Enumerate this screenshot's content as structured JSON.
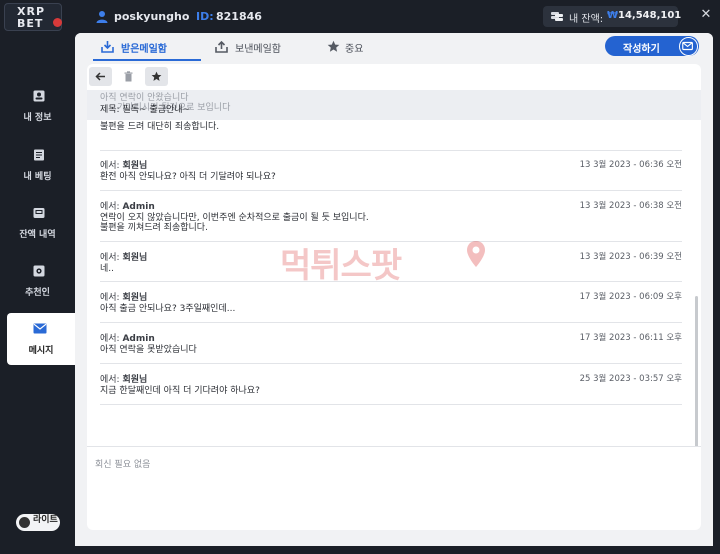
{
  "topbar": {
    "logo_line1": "XRP",
    "logo_line2": "BET",
    "username": "poskyungho",
    "id_label": "ID:",
    "id_value": "821846",
    "balance_label": "내 잔액:",
    "balance_currency": "₩",
    "balance_value": "14,548,101",
    "close_glyph": "✕"
  },
  "sidebar": {
    "items": [
      {
        "label": "내 정보",
        "icon": "id-card-icon"
      },
      {
        "label": "내 베팅",
        "icon": "ledger-icon"
      },
      {
        "label": "잔액 내역",
        "icon": "wallet-icon"
      },
      {
        "label": "추천인",
        "icon": "referral-icon"
      },
      {
        "label": "메시지",
        "icon": "envelope-icon"
      }
    ],
    "toggle_label": "라이트"
  },
  "tabs": {
    "inbox": "받은메일함",
    "sent": "보낸메일함",
    "important": "중요",
    "compose": "작성하기"
  },
  "thread": {
    "ghost_line1": "아직 연락이 안왔습니다",
    "ghost_line2": "기다리시면 될것으로 보입니다",
    "subject": "제목: 필독~ 출금안내~",
    "top_body": "불편을 드려 대단히 죄송합니다.",
    "messages": [
      {
        "from_prefix": "에서:",
        "from": "회원님",
        "date": "13 3월 2023 - 06:36 오전",
        "body": [
          "환전 아직 안되나요? 아직 더 기달려야 되나요?"
        ]
      },
      {
        "from_prefix": "에서:",
        "from": "Admin",
        "date": "13 3월 2023 - 06:38 오전",
        "body": [
          "연락이 오지 않았습니다만, 이번주엔 순차적으로 출금이 될 듯 보입니다.",
          "불편을 끼쳐드려 죄송합니다."
        ]
      },
      {
        "from_prefix": "에서:",
        "from": "회원님",
        "date": "13 3월 2023 - 06:39 오전",
        "body": [
          "네.."
        ]
      },
      {
        "from_prefix": "에서:",
        "from": "회원님",
        "date": "17 3월 2023 - 06:09 오후",
        "body": [
          "아직 출금 안되나요? 3주일째인데..."
        ]
      },
      {
        "from_prefix": "에서:",
        "from": "Admin",
        "date": "17 3월 2023 - 06:11 오후",
        "body": [
          "아직 연락을 못받았습니다"
        ]
      },
      {
        "from_prefix": "에서:",
        "from": "회원님",
        "date": "25 3월 2023 - 03:57 오후",
        "body": [
          "지금 한달째인데 아직 더 기다려야 하나요?"
        ]
      }
    ],
    "reply_note": "회신 필요 없음"
  },
  "watermark": {
    "text": "먹튀스팟"
  },
  "colors": {
    "accent": "#2463d1",
    "background": "#1b1f27",
    "panel": "#f1f2f4",
    "watermark": "#d62828"
  }
}
